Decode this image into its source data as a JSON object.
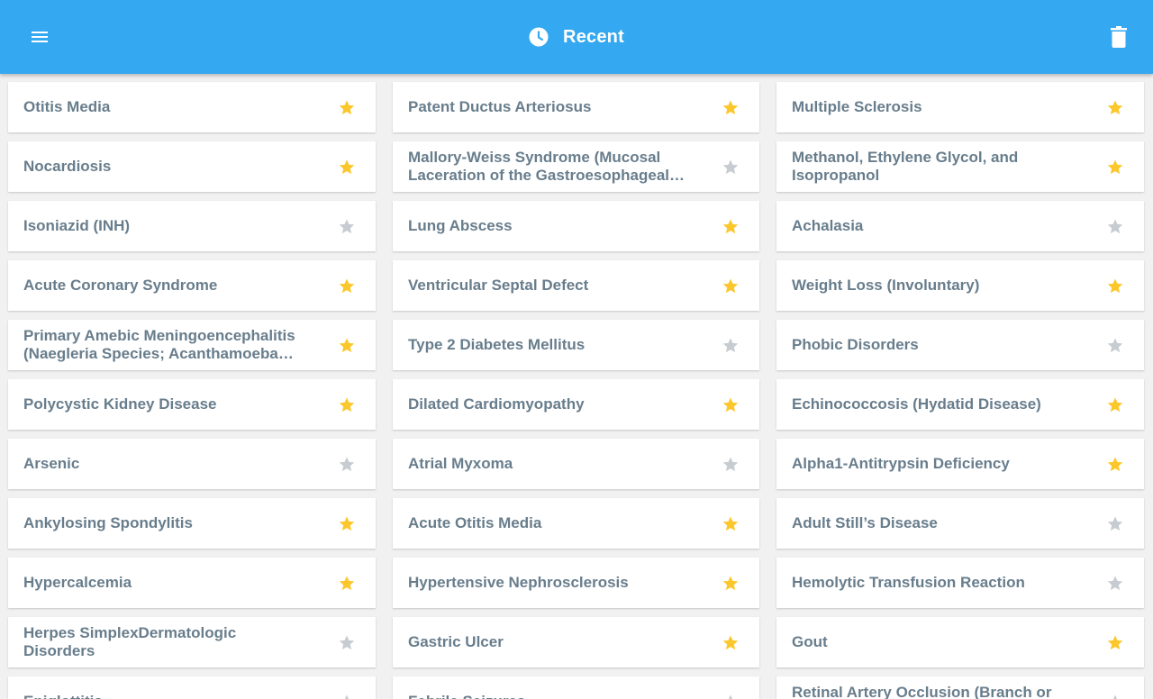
{
  "app_bar": {
    "title": "Recent",
    "menu_icon": "menu-icon",
    "title_icon": "clock-icon",
    "action_icon": "trash-icon"
  },
  "colors": {
    "app_bar": "#34a8f0",
    "star_on": "#fcc72a",
    "star_off": "#c6ccd1",
    "text": "#687d8c"
  },
  "items": [
    {
      "label": "Otitis Media",
      "starred": true
    },
    {
      "label": "Patent Ductus Arteriosus",
      "starred": true
    },
    {
      "label": "Multiple Sclerosis",
      "starred": true
    },
    {
      "label": "Nocardiosis",
      "starred": true
    },
    {
      "label": "Mallory-Weiss Syndrome (Mucosal Laceration of the Gastroesophageal Junction)",
      "starred": false
    },
    {
      "label": "Methanol, Ethylene Glycol, and Isopropanol",
      "starred": true
    },
    {
      "label": "Isoniazid (INH)",
      "starred": false
    },
    {
      "label": "Lung Abscess",
      "starred": true
    },
    {
      "label": "Achalasia",
      "starred": false
    },
    {
      "label": "Acute Coronary Syndrome",
      "starred": true
    },
    {
      "label": "Ventricular Septal Defect",
      "starred": true
    },
    {
      "label": "Weight Loss (Involuntary)",
      "starred": true
    },
    {
      "label": "Primary Amebic Meningoencephalitis (Naegleria Species; Acanthamoeba Species)",
      "starred": true
    },
    {
      "label": "Type 2 Diabetes Mellitus",
      "starred": false
    },
    {
      "label": "Phobic Disorders",
      "starred": false
    },
    {
      "label": "Polycystic Kidney Disease",
      "starred": true
    },
    {
      "label": "Dilated Cardiomyopathy",
      "starred": true
    },
    {
      "label": "Echinococcosis (Hydatid Disease)",
      "starred": true
    },
    {
      "label": "Arsenic",
      "starred": false
    },
    {
      "label": "Atrial Myxoma",
      "starred": false
    },
    {
      "label": "Alpha1-Antitrypsin Deficiency",
      "starred": true
    },
    {
      "label": "Ankylosing Spondylitis",
      "starred": true
    },
    {
      "label": "Acute Otitis Media",
      "starred": true
    },
    {
      "label": "Adult Still’s Disease",
      "starred": false
    },
    {
      "label": "Hypercalcemia",
      "starred": true
    },
    {
      "label": "Hypertensive Nephrosclerosis",
      "starred": true
    },
    {
      "label": "Hemolytic Transfusion Reaction",
      "starred": false
    },
    {
      "label": "Herpes SimplexDermatologic Disorders",
      "starred": false
    },
    {
      "label": "Gastric Ulcer",
      "starred": true
    },
    {
      "label": "Gout",
      "starred": true
    },
    {
      "label": "Epiglottitis",
      "starred": false
    },
    {
      "label": "Febrile Seizures",
      "starred": false
    },
    {
      "label": "Retinal Artery Occlusion (Branch or Central)",
      "starred": false
    }
  ]
}
